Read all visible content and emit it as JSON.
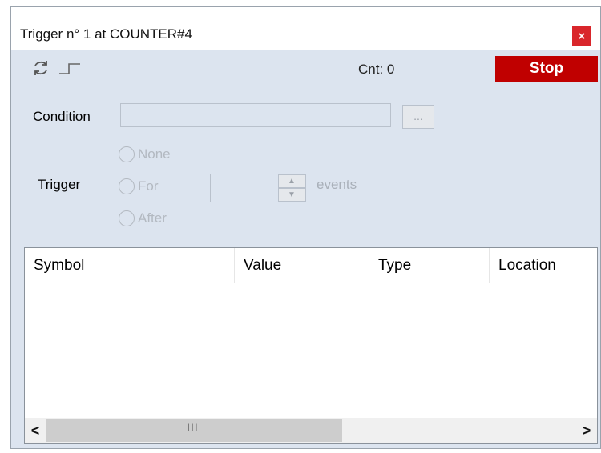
{
  "window": {
    "title": "Trigger n° 1 at COUNTER#4",
    "close_label": "×"
  },
  "toolbar": {
    "counter_text": "Cnt: 0",
    "stop_label": "Stop"
  },
  "condition": {
    "label": "Condition",
    "value": "",
    "browse_label": "..."
  },
  "trigger": {
    "label": "Trigger",
    "options": [
      "None",
      "For",
      "After"
    ],
    "count_value": "",
    "units_label": "events"
  },
  "table": {
    "columns": [
      "Symbol",
      "Value",
      "Type",
      "Location"
    ],
    "rows": []
  },
  "scrollbar": {
    "left_arrow": "<",
    "right_arrow": ">",
    "grip": "III"
  },
  "colors": {
    "stop_button": "#c00000",
    "close_button": "#d9262b",
    "panel_background": "#dce4ef"
  }
}
